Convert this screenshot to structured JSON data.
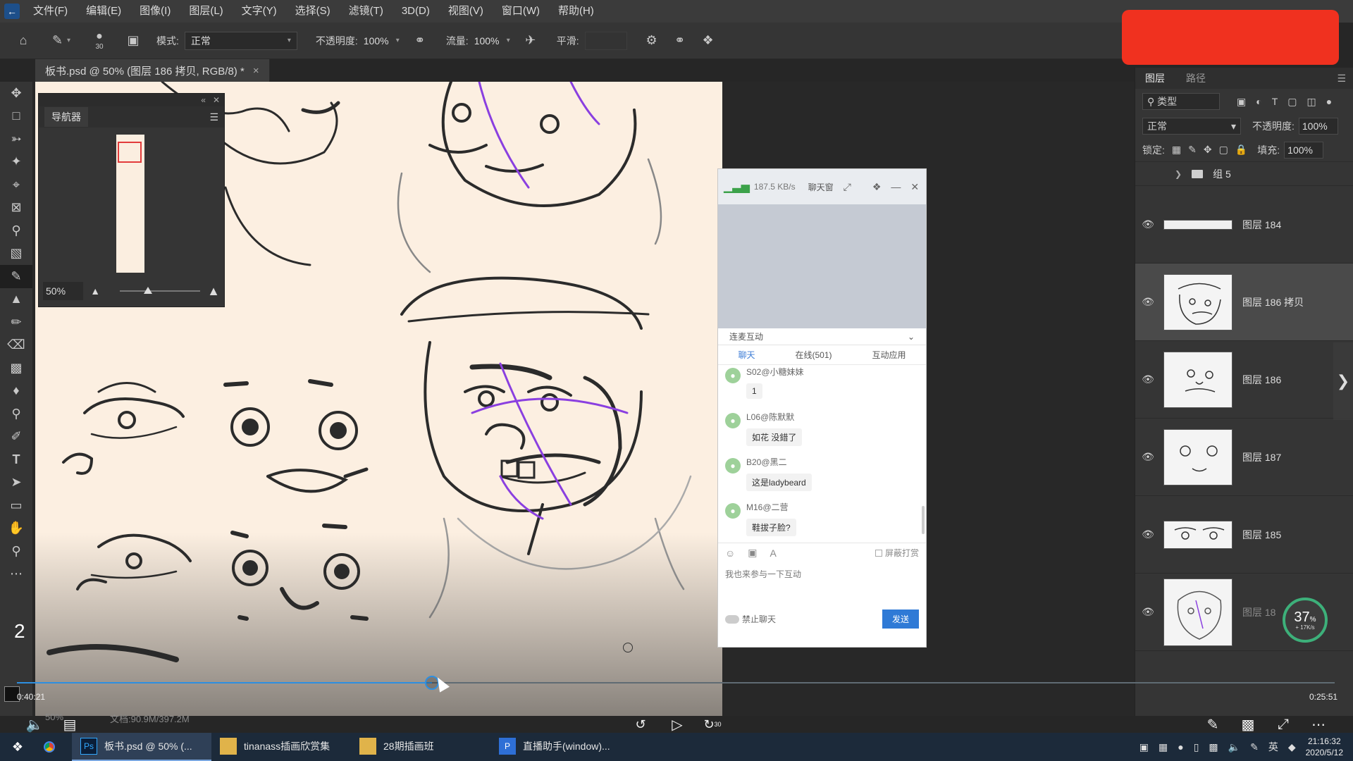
{
  "menubar": {
    "items": [
      "文件(F)",
      "编辑(E)",
      "图像(I)",
      "图层(L)",
      "文字(Y)",
      "选择(S)",
      "滤镜(T)",
      "3D(D)",
      "视图(V)",
      "窗口(W)",
      "帮助(H)"
    ]
  },
  "options": {
    "brush_size": "30",
    "mode_label": "模式:",
    "mode_value": "正常",
    "opacity_label": "不透明度:",
    "opacity_value": "100%",
    "flow_label": "流量:",
    "flow_value": "100%",
    "smooth_label": "平滑:"
  },
  "document": {
    "tab_title": "板书.psd @ 50% (图层 186 拷贝, RGB/8) *",
    "close": "×"
  },
  "navigator": {
    "title": "导航器",
    "zoom": "50%"
  },
  "chat": {
    "speed": "187.5 KB/s",
    "title_label": "聊天窗",
    "section": "连麦互动",
    "tabs": [
      "聊天",
      "在线(501)",
      "互动应用"
    ],
    "messages": [
      {
        "name": "S02@小糖妹妹",
        "text": "1"
      },
      {
        "name": "L06@陈默默",
        "text": "如花 没錯了"
      },
      {
        "name": "B20@黑二",
        "text": "这是ladybeard"
      },
      {
        "name": "M16@二营",
        "text": "鞋拔子脸?"
      }
    ],
    "block_label": "屏蔽打赏",
    "input_placeholder": "我也来参与一下互动",
    "mute_label": "禁止聊天",
    "send_label": "发送"
  },
  "layers": {
    "tabs": [
      "图层",
      "路径"
    ],
    "filter_label": "类型",
    "blend_mode": "正常",
    "opacity_label": "不透明度:",
    "opacity_value": "100%",
    "lock_label": "锁定:",
    "fill_label": "填充:",
    "fill_value": "100%",
    "group_name": "组 5",
    "items": [
      {
        "name": "图层 184"
      },
      {
        "name": "图层 186 拷贝"
      },
      {
        "name": "图层 186"
      },
      {
        "name": "图层 187"
      },
      {
        "name": "图层 185"
      },
      {
        "name": "图层 18"
      }
    ]
  },
  "overlay": {
    "progress_value": "37",
    "progress_unit": "%",
    "progress_sub": "+ 17K/s",
    "step_number": "2"
  },
  "video": {
    "current_time": "0:40:21",
    "total_time": "0:25:51",
    "progress": 0.315,
    "rewind_label": "",
    "forward_label": "30",
    "status_zoom": "50%",
    "status_doc": "文档:90.9M/397.2M"
  },
  "taskbar": {
    "apps": [
      {
        "icon": "Ps",
        "label": "板书.psd @ 50% (..."
      },
      {
        "icon": "",
        "label": "tinanass插画欣赏集"
      },
      {
        "icon": "",
        "label": "28期插画班"
      },
      {
        "icon": "P",
        "label": "直播助手(window)..."
      }
    ],
    "ime": "英",
    "time": "21:16:32",
    "date": "2020/5/12"
  },
  "colors": {
    "accent": "#2d8fe0",
    "red_box": "#f0311f",
    "canvas": "#fcefe1",
    "stroke_purple": "#8a3fe0"
  }
}
